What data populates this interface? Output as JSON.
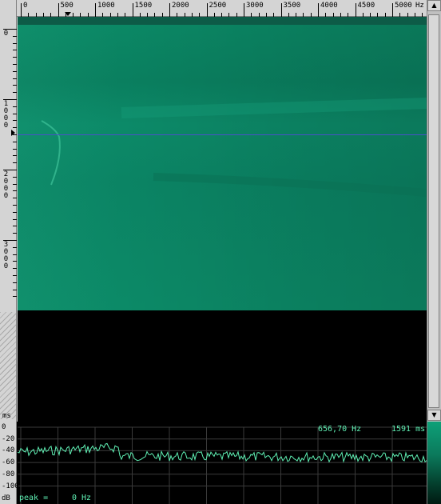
{
  "freq_axis": {
    "labels": [
      "0",
      "500",
      "1000",
      "1500",
      "2000",
      "2500",
      "3000",
      "3500",
      "4000",
      "4500",
      "5000"
    ],
    "unit": "Hz"
  },
  "time_axis": {
    "labels": [
      "0",
      "1000",
      "2000",
      "3000"
    ],
    "unit": "ms"
  },
  "db_axis": {
    "labels": [
      "0",
      "-20",
      "-40",
      "-60",
      "-80",
      "-100"
    ],
    "unit": "dB"
  },
  "readout": {
    "frequency": "656,70 Hz",
    "time": "1591 ms",
    "peak_label": "peak =",
    "peak_value": "0 Hz"
  },
  "scrollbar": {
    "up_arrow": "▲",
    "down_arrow": "▼"
  },
  "colors": {
    "spectrogram": "#0b8865",
    "cursor": "#4a50c8",
    "trace": "#5ff0b4",
    "grid": "#3a3a3a"
  }
}
